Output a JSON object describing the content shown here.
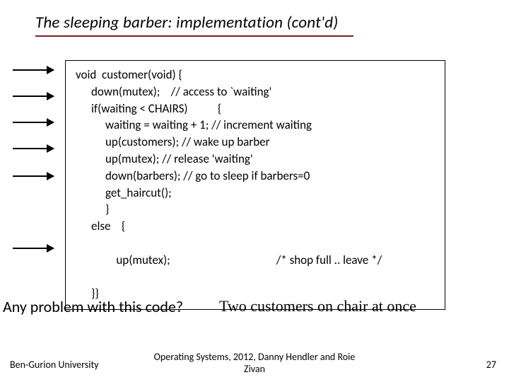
{
  "title": "The sleeping barber: implementation (cont'd)",
  "code": {
    "l0": "void  customer(void) {",
    "l1": "down(mutex);    // access to `waiting'",
    "l2": "if(waiting < CHAIRS)           {",
    "l3": "waiting = waiting + 1; // increment waiting",
    "l4": "up(customers); // wake up barber",
    "l5": "up(mutex); // release 'waiting'",
    "l6": "down(barbers); // go to sleep if barbers=0",
    "l7": "get_haircut();",
    "l8": "}",
    "l9": "else    {",
    "l10a": "up(mutex);",
    "l10b": "/* shop full .. leave */",
    "l11": "}}"
  },
  "question": "Any problem with this code?",
  "answer": "Two customers on chair at once",
  "footer_left": "Ben-Gurion University",
  "footer_center1": "Operating Systems, 2012, Danny Hendler and Roie",
  "footer_center2": "Zivan",
  "page": "27"
}
